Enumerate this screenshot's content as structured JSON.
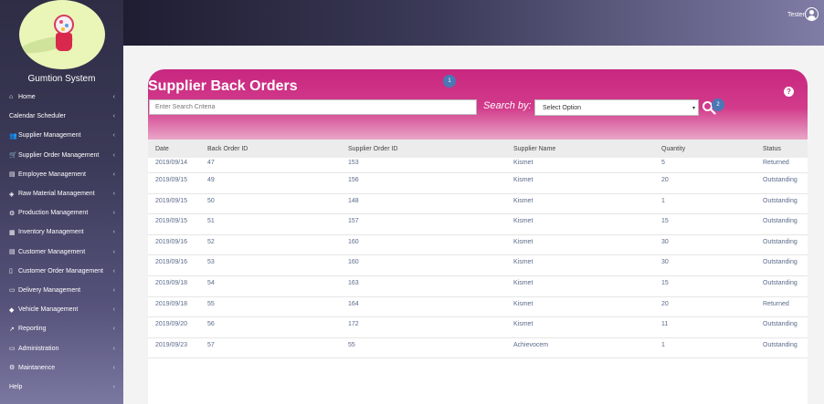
{
  "app": {
    "name": "Gumtion System"
  },
  "user": {
    "name": "Tester"
  },
  "sidebar": {
    "items": [
      {
        "label": "Home",
        "icon": "home-icon",
        "glyph": "⌂"
      },
      {
        "label": "Calendar Scheduler",
        "icon": "",
        "glyph": ""
      },
      {
        "label": "Supplier Management",
        "icon": "users-icon",
        "glyph": "👥"
      },
      {
        "label": "Supplier Order Management",
        "icon": "truck-icon",
        "glyph": "🛒"
      },
      {
        "label": "Employee Management",
        "icon": "id-card-icon",
        "glyph": "▤"
      },
      {
        "label": "Raw Material Management",
        "icon": "box-icon",
        "glyph": "◈"
      },
      {
        "label": "Production Management",
        "icon": "cogs-icon",
        "glyph": "⚙"
      },
      {
        "label": "Inventory Management",
        "icon": "inventory-icon",
        "glyph": "▦"
      },
      {
        "label": "Customer Management",
        "icon": "customer-icon",
        "glyph": "▤"
      },
      {
        "label": "Customer Order Management",
        "icon": "file-icon",
        "glyph": "▯"
      },
      {
        "label": "Delivery Management",
        "icon": "delivery-truck-icon",
        "glyph": "▭"
      },
      {
        "label": "Vehicle Management",
        "icon": "car-icon",
        "glyph": "◆"
      },
      {
        "label": "Reporting",
        "icon": "chart-icon",
        "glyph": "↗"
      },
      {
        "label": "Administration",
        "icon": "laptop-icon",
        "glyph": "▭"
      },
      {
        "label": "Maintanence",
        "icon": "gear-icon",
        "glyph": "⚙"
      },
      {
        "label": "Help",
        "icon": "",
        "glyph": ""
      }
    ],
    "chevron": "‹"
  },
  "panel": {
    "title": "Supplier Back Orders",
    "badge1": "1",
    "badge2": "2",
    "help": "?",
    "search_placeholder": "Enter Search Criteria",
    "search_by_label": "Search by:",
    "select_value": "Select Option",
    "select_arrow": "▾"
  },
  "table": {
    "headers": [
      "Date",
      "Back Order ID",
      "Supplier Order ID",
      "Supplier Name",
      "Quantity",
      "Status"
    ],
    "rows": [
      [
        "2019/09/14",
        "47",
        "153",
        "Kismet",
        "5",
        "Returned"
      ],
      [
        "2019/09/15",
        "49",
        "156",
        "Kismet",
        "20",
        "Outstanding"
      ],
      [
        "2019/09/15",
        "50",
        "148",
        "Kismet",
        "1",
        "Outstanding"
      ],
      [
        "2019/09/15",
        "51",
        "157",
        "Kismet",
        "15",
        "Outstanding"
      ],
      [
        "2019/09/16",
        "52",
        "160",
        "Kismet",
        "30",
        "Outstanding"
      ],
      [
        "2019/09/16",
        "53",
        "160",
        "Kismet",
        "30",
        "Outstanding"
      ],
      [
        "2019/09/18",
        "54",
        "163",
        "Kismet",
        "15",
        "Outstanding"
      ],
      [
        "2019/09/18",
        "55",
        "164",
        "Kismet",
        "20",
        "Returned"
      ],
      [
        "2019/09/20",
        "56",
        "172",
        "Kismet",
        "11",
        "Outstanding"
      ],
      [
        "2019/09/23",
        "57",
        "55",
        "Achievocem",
        "1",
        "Outstanding"
      ]
    ]
  },
  "colors": {
    "sidebar_bg": "#3b3a58",
    "panel_header": "#c8277f",
    "badge": "#4a78b5",
    "table_text": "#5a6a8a"
  }
}
